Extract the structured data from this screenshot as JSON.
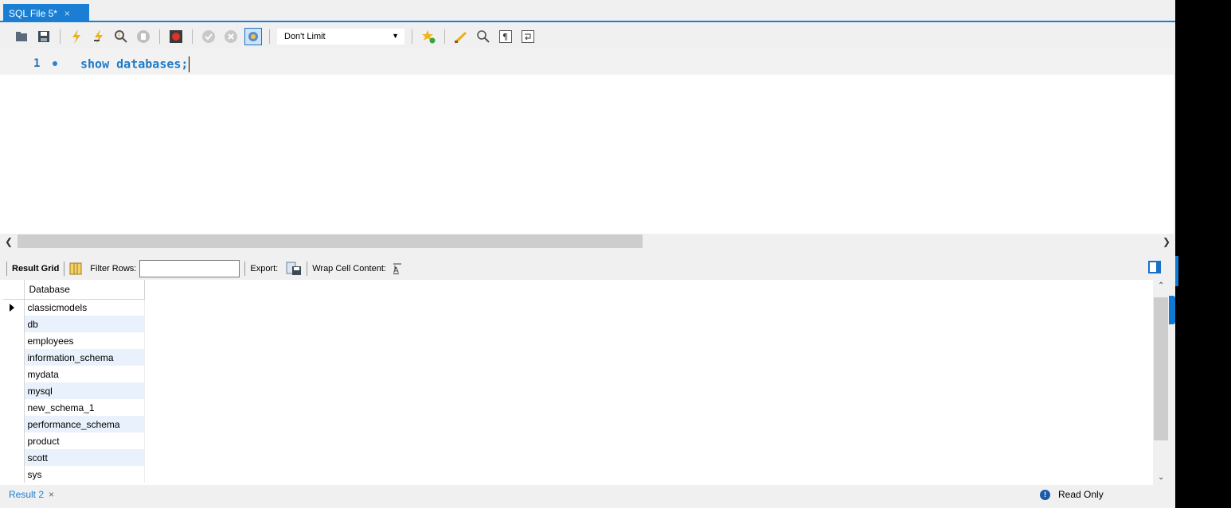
{
  "tabbar": {
    "tab_label": "SQL File 5*",
    "close_glyph": "×"
  },
  "toolbar": {
    "icons": [
      "open-folder-icon",
      "save-icon",
      "execute-icon",
      "execute-current-icon",
      "explain-icon",
      "stop-icon",
      "toggle-error-icon",
      "commit-icon",
      "rollback-icon",
      "autocommit-icon",
      "add-snippet-icon",
      "beautify-icon",
      "find-icon",
      "invisible-chars-icon",
      "word-wrap-icon"
    ],
    "limit_value": "Don't Limit"
  },
  "editor": {
    "line_number": "1",
    "code": "show databases;"
  },
  "result_toolbar": {
    "result_grid_label": "Result Grid",
    "filter_rows_label": "Filter Rows:",
    "filter_rows_value": "",
    "export_label": "Export:",
    "wrap_label": "Wrap Cell Content:"
  },
  "grid": {
    "column": "Database",
    "rows": [
      "classicmodels",
      "db",
      "employees",
      "information_schema",
      "mydata",
      "mysql",
      "new_schema_1",
      "performance_schema",
      "product",
      "scott",
      "sys"
    ]
  },
  "bottom": {
    "result_tab": "Result 2",
    "close_glyph": "×",
    "status": "Read Only"
  },
  "colors": {
    "accent": "#1a7fd4",
    "keyword": "#1c79c9",
    "row_alt": "#e9f1fc"
  }
}
